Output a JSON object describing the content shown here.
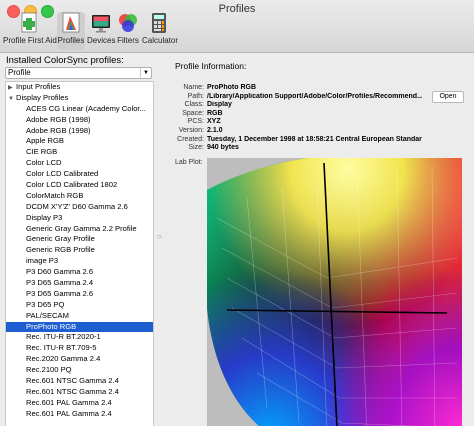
{
  "window": {
    "title": "Profiles"
  },
  "toolbar": {
    "items": [
      {
        "label": "Profile First Aid",
        "icon": "first-aid-icon"
      },
      {
        "label": "Profiles",
        "icon": "profiles-icon",
        "selected": true
      },
      {
        "label": "Devices",
        "icon": "devices-icon"
      },
      {
        "label": "Filters",
        "icon": "filters-icon"
      },
      {
        "label": "Calculator",
        "icon": "calculator-icon"
      }
    ]
  },
  "sidebar": {
    "header": "Installed ColorSync profiles:",
    "filter_value": "Profile",
    "groups": [
      {
        "label": "Input Profiles",
        "expanded": false
      },
      {
        "label": "Display Profiles",
        "expanded": true
      }
    ],
    "items": [
      "ACES CG Linear (Academy Color...",
      "Adobe RGB (1998)",
      "Adobe RGB (1998)",
      "Apple RGB",
      "CIE RGB",
      "Color LCD",
      "Color LCD Calibrated",
      "Color LCD Calibrated 1802",
      "ColorMatch RGB",
      "DCDM X'Y'Z' D60 Gamma 2.6",
      "Display P3",
      "Generic Gray Gamma 2.2 Profile",
      "Generic Gray Profile",
      "Generic RGB Profile",
      "image P3",
      "P3 D60 Gamma 2.6",
      "P3 D65 Gamma 2.4",
      "P3 D65 Gamma 2.6",
      "P3 D65 PQ",
      "PAL/SECAM",
      "ProPhoto RGB",
      "Rec. ITU-R BT.2020-1",
      "Rec. ITU-R BT.709-5",
      "Rec.2020 Gamma 2.4",
      "Rec.2100 PQ",
      "Rec.601 NTSC Gamma 2.4",
      "Rec.601 NTSC Gamma 2.4",
      "Rec.601 PAL Gamma 2.4",
      "Rec.601 PAL Gamma 2.4"
    ],
    "selected_index": 20
  },
  "profile_info": {
    "heading": "Profile Information:",
    "fields": [
      {
        "key": "Name:",
        "value": "ProPhoto RGB"
      },
      {
        "key": "Path:",
        "value": "/Library/Application Support/Adobe/Color/Profiles/Recommend..."
      },
      {
        "key": "Class:",
        "value": "Display"
      },
      {
        "key": "Space:",
        "value": "RGB"
      },
      {
        "key": "PCS:",
        "value": "XYZ"
      },
      {
        "key": "Version:",
        "value": "2.1.0"
      },
      {
        "key": "Created:",
        "value": "Tuesday, 1 December 1998 at 18:58:21 Central European Standard Time"
      },
      {
        "key": "Size:",
        "value": "940 bytes"
      }
    ],
    "open_label": "Open",
    "lab_plot_label": "Lab Plot:"
  }
}
